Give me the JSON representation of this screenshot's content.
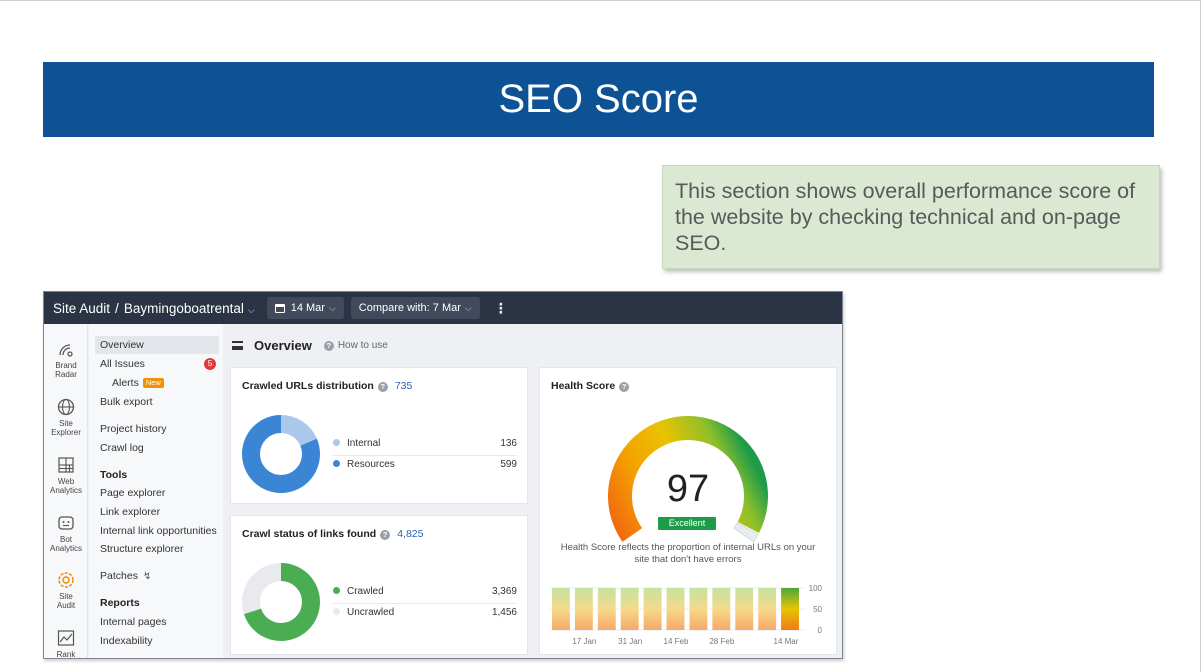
{
  "slide": {
    "title": "SEO Score",
    "note": "This section shows overall performance score of the website by checking technical and on-page SEO."
  },
  "topbar": {
    "title": "Site Audit",
    "separator": "/",
    "project": "Baymingoboatrental",
    "date": "14 Mar",
    "compare": "Compare with: 7 Mar"
  },
  "rail": {
    "items": [
      {
        "label": "Brand\nRadar",
        "icon": "radar-icon"
      },
      {
        "label": "Site\nExplorer",
        "icon": "globe-icon"
      },
      {
        "label": "Web\nAnalytics",
        "icon": "grid-chart-icon"
      },
      {
        "label": "Bot\nAnalytics",
        "icon": "bot-icon"
      },
      {
        "label": "Site\nAudit",
        "icon": "audit-gear-icon"
      },
      {
        "label": "Rank",
        "icon": "rank-chart-icon"
      }
    ]
  },
  "nav": {
    "overview": "Overview",
    "all_issues": "All Issues",
    "issues_badge": "5",
    "alerts": "Alerts",
    "alerts_tag": "New",
    "bulk_export": "Bulk export",
    "project_history": "Project history",
    "crawl_log": "Crawl log",
    "tools_head": "Tools",
    "page_explorer": "Page explorer",
    "link_explorer": "Link explorer",
    "internal_link_opps": "Internal link opportunities",
    "structure_explorer": "Structure explorer",
    "patches": "Patches",
    "reports_head": "Reports",
    "internal_pages": "Internal pages",
    "indexability": "Indexability"
  },
  "main": {
    "heading": "Overview",
    "how_to": "How to use"
  },
  "crawled": {
    "title": "Crawled URLs distribution",
    "total": "735",
    "items": [
      {
        "label": "Internal",
        "value": "136",
        "color": "#a9c8ec"
      },
      {
        "label": "Resources",
        "value": "599",
        "color": "#3a86d4"
      }
    ]
  },
  "crawlstatus": {
    "title": "Crawl status of links found",
    "total": "4,825",
    "items": [
      {
        "label": "Crawled",
        "value": "3,369",
        "color": "#4aad52"
      },
      {
        "label": "Uncrawled",
        "value": "1,456",
        "color": "#e8eaed"
      }
    ]
  },
  "health": {
    "title": "Health Score",
    "score": "97",
    "rating": "Excellent",
    "description": "Health Score reflects the proportion of internal URLs on your site that don't have errors"
  },
  "chart_data": {
    "type": "bar",
    "x_ticks": [
      "17 Jan",
      "31 Jan",
      "14 Feb",
      "28 Feb",
      "14 Mar"
    ],
    "values": [
      100,
      100,
      100,
      100,
      100,
      100,
      100,
      100,
      100,
      100,
      100
    ],
    "y_ticks": [
      "100",
      "50",
      "0"
    ],
    "ylim": [
      0,
      100
    ],
    "colors": {
      "bar_top": "#c4e3a0",
      "bar_bottom": "#f6a86a",
      "last_top": "#4aa83e",
      "last_bottom": "#f07a1a"
    }
  }
}
